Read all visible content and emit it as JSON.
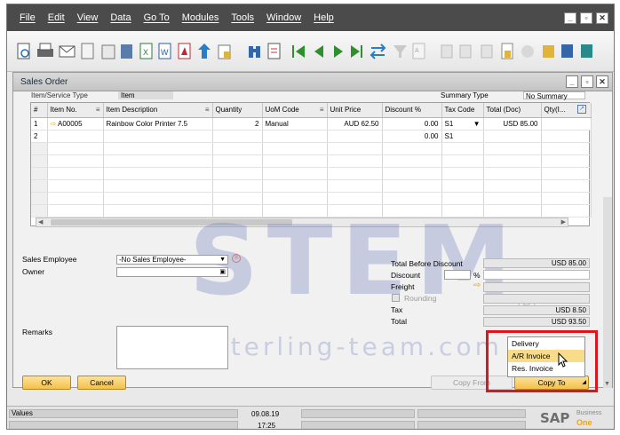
{
  "menu": [
    "File",
    "Edit",
    "View",
    "Data",
    "Go To",
    "Modules",
    "Tools",
    "Window",
    "Help"
  ],
  "window_title": "Sales Order",
  "header": {
    "item_service_type_label": "Item/Service Type",
    "item_service_type_value": "Item",
    "summary_type_label": "Summary Type",
    "summary_type_value": "No Summary"
  },
  "grid": {
    "columns": [
      "#",
      "Item No.",
      "Item Description",
      "Quantity",
      "UoM Code",
      "Unit Price",
      "Discount %",
      "Tax Code",
      "Total (Doc)",
      "Qty(I..."
    ],
    "rows": [
      [
        "1",
        "A00005",
        "Rainbow Color Printer 7.5",
        "2",
        "Manual",
        "AUD 62.50",
        "0.00",
        "S1",
        "USD 85.00",
        ""
      ],
      [
        "2",
        "",
        "",
        "",
        "",
        "",
        "0.00",
        "S1",
        "",
        ""
      ]
    ]
  },
  "left": {
    "sales_employee_label": "Sales Employee",
    "sales_employee_value": "-No Sales Employee-",
    "owner_label": "Owner",
    "remarks_label": "Remarks"
  },
  "totals": {
    "total_before_discount_label": "Total Before Discount",
    "total_before_discount_value": "USD 85.00",
    "discount_label": "Discount",
    "discount_pct": "%",
    "freight_label": "Freight",
    "rounding_label": "Rounding",
    "tax_label": "Tax",
    "tax_value": "USD 8.50",
    "total_label": "Total",
    "total_value": "USD 93.50"
  },
  "buttons": {
    "ok": "OK",
    "cancel": "Cancel",
    "copy_from": "Copy From",
    "copy_to": "Copy To"
  },
  "copy_to_menu": [
    "Delivery",
    "A/R Invoice",
    "Res. Invoice"
  ],
  "status": {
    "values_label": "Values",
    "date": "09.08.19",
    "time": "17:25"
  },
  "brand": {
    "sap": "SAP",
    "business": "Business",
    "one": "One"
  },
  "watermark": {
    "main": "STEM",
    "sub": "www.sterling-team.com",
    "reg": "®"
  },
  "colors": {
    "highlight": "#f8dc8a",
    "red_frame": "#e0141c",
    "gold_button": "#f4c04c"
  }
}
